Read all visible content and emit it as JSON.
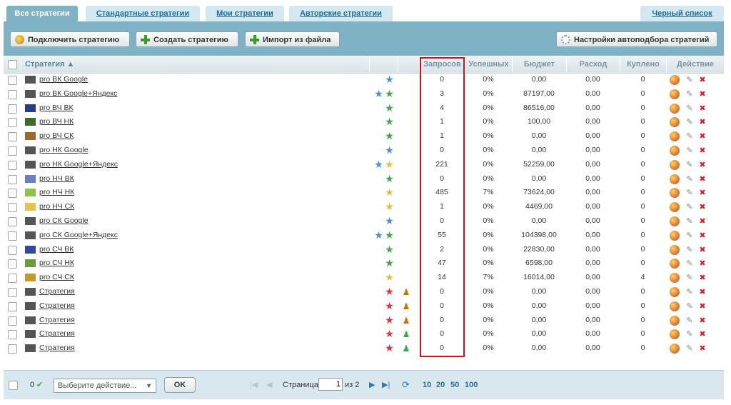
{
  "tabs": [
    {
      "label": "Все стратегии",
      "active": true
    },
    {
      "label": "Стандартные стратегии",
      "active": false
    },
    {
      "label": "Мои стратегии",
      "active": false
    },
    {
      "label": "Авторские стратегии",
      "active": false
    },
    {
      "label": "Черный список",
      "active": false
    }
  ],
  "toolbar": {
    "connect_label": "Подключить стратегию",
    "create_label": "Создать стратегию",
    "import_label": "Импорт из файла",
    "autoselect_label": "Настройки автоподбора стратегий"
  },
  "columns": {
    "strategy": "Стратегия ▲",
    "requests": "Запросов",
    "success": "Успешных",
    "budget": "Бюджет",
    "spend": "Расход",
    "bought": "Куплено",
    "action": "Действие"
  },
  "rows": [
    {
      "name": "pro ВК Google",
      "color": "#555555",
      "stars": [
        "blue"
      ],
      "person": "",
      "requests": "0",
      "success": "0%",
      "budget": "0,00",
      "spend": "0,00",
      "bought": "0"
    },
    {
      "name": "pro ВК Google+Яндекс",
      "color": "#555555",
      "stars": [
        "blue",
        "green"
      ],
      "person": "",
      "requests": "3",
      "success": "0%",
      "budget": "87197,00",
      "spend": "0,00",
      "bought": "0"
    },
    {
      "name": "pro ВЧ ВК",
      "color": "#2a3a8a",
      "stars": [
        "green"
      ],
      "person": "",
      "requests": "4",
      "success": "0%",
      "budget": "86516,00",
      "spend": "0,00",
      "bought": "0"
    },
    {
      "name": "pro ВЧ НК",
      "color": "#3f6b22",
      "stars": [
        "green"
      ],
      "person": "",
      "requests": "1",
      "success": "0%",
      "budget": "100,00",
      "spend": "0,00",
      "bought": "0"
    },
    {
      "name": "pro ВЧ СК",
      "color": "#9a6a2a",
      "stars": [
        "green"
      ],
      "person": "",
      "requests": "1",
      "success": "0%",
      "budget": "0,00",
      "spend": "0,00",
      "bought": "0"
    },
    {
      "name": "pro НК Google",
      "color": "#555555",
      "stars": [
        "blue"
      ],
      "person": "",
      "requests": "0",
      "success": "0%",
      "budget": "0,00",
      "spend": "0,00",
      "bought": "0"
    },
    {
      "name": "pro НК Google+Яндекс",
      "color": "#555555",
      "stars": [
        "blue",
        "yellow"
      ],
      "person": "",
      "requests": "221",
      "success": "0%",
      "budget": "52259,00",
      "spend": "0,00",
      "bought": "0"
    },
    {
      "name": "pro НЧ ВК",
      "color": "#6a7fc4",
      "stars": [
        "green"
      ],
      "person": "",
      "requests": "0",
      "success": "0%",
      "budget": "0,00",
      "spend": "0,00",
      "bought": "0"
    },
    {
      "name": "pro НЧ НК",
      "color": "#8fc24a",
      "stars": [
        "yellow"
      ],
      "person": "",
      "requests": "485",
      "success": "7%",
      "budget": "73624,00",
      "spend": "0,00",
      "bought": "0"
    },
    {
      "name": "pro НЧ СК",
      "color": "#e8c24a",
      "stars": [
        "yellow"
      ],
      "person": "",
      "requests": "1",
      "success": "0%",
      "budget": "4469,00",
      "spend": "0,00",
      "bought": "0"
    },
    {
      "name": "pro СК Google",
      "color": "#555555",
      "stars": [
        "blue"
      ],
      "person": "",
      "requests": "0",
      "success": "0%",
      "budget": "0,00",
      "spend": "0,00",
      "bought": "0"
    },
    {
      "name": "pro СК Google+Яндекс",
      "color": "#555555",
      "stars": [
        "blue",
        "green"
      ],
      "person": "",
      "requests": "55",
      "success": "0%",
      "budget": "104398,00",
      "spend": "0,00",
      "bought": "0"
    },
    {
      "name": "pro СЧ ВК",
      "color": "#33489a",
      "stars": [
        "green"
      ],
      "person": "",
      "requests": "2",
      "success": "0%",
      "budget": "22830,00",
      "spend": "0,00",
      "bought": "0"
    },
    {
      "name": "pro СЧ НК",
      "color": "#6e9a3a",
      "stars": [
        "green"
      ],
      "person": "",
      "requests": "47",
      "success": "0%",
      "budget": "6598,00",
      "spend": "0,00",
      "bought": "0"
    },
    {
      "name": "pro СЧ СК",
      "color": "#c49a2a",
      "stars": [
        "yellow"
      ],
      "person": "",
      "requests": "14",
      "success": "7%",
      "budget": "16014,00",
      "spend": "0,00",
      "bought": "4"
    },
    {
      "name": "Стратегия",
      "color": "#555555",
      "stars": [
        "red"
      ],
      "person": "user",
      "requests": "0",
      "success": "0%",
      "budget": "0,00",
      "spend": "0,00",
      "bought": "0"
    },
    {
      "name": "Стратегия",
      "color": "#555555",
      "stars": [
        "red"
      ],
      "person": "user",
      "requests": "0",
      "success": "0%",
      "budget": "0,00",
      "spend": "0,00",
      "bought": "0"
    },
    {
      "name": "Стратегия",
      "color": "#555555",
      "stars": [
        "red"
      ],
      "person": "user",
      "requests": "0",
      "success": "0%",
      "budget": "0,00",
      "spend": "0,00",
      "bought": "0"
    },
    {
      "name": "Стратегия",
      "color": "#555555",
      "stars": [
        "red"
      ],
      "person": "user-money",
      "requests": "0",
      "success": "0%",
      "budget": "0,00",
      "spend": "0,00",
      "bought": "0"
    },
    {
      "name": "Стратегия",
      "color": "#555555",
      "stars": [
        "red"
      ],
      "person": "user-money",
      "requests": "0",
      "success": "0%",
      "budget": "0,00",
      "spend": "0,00",
      "bought": "0"
    }
  ],
  "star_colors": {
    "blue": "#4a90d9",
    "green": "#3aa84a",
    "yellow": "#d4c23a",
    "red": "#d8323a"
  },
  "footer": {
    "selected_count": "0",
    "action_placeholder": "Выберите действие...",
    "ok_label": "OK",
    "page_label": "Страница",
    "page_value": "1",
    "page_of": "из 2",
    "page_sizes": [
      "10",
      "20",
      "50",
      "100"
    ]
  }
}
